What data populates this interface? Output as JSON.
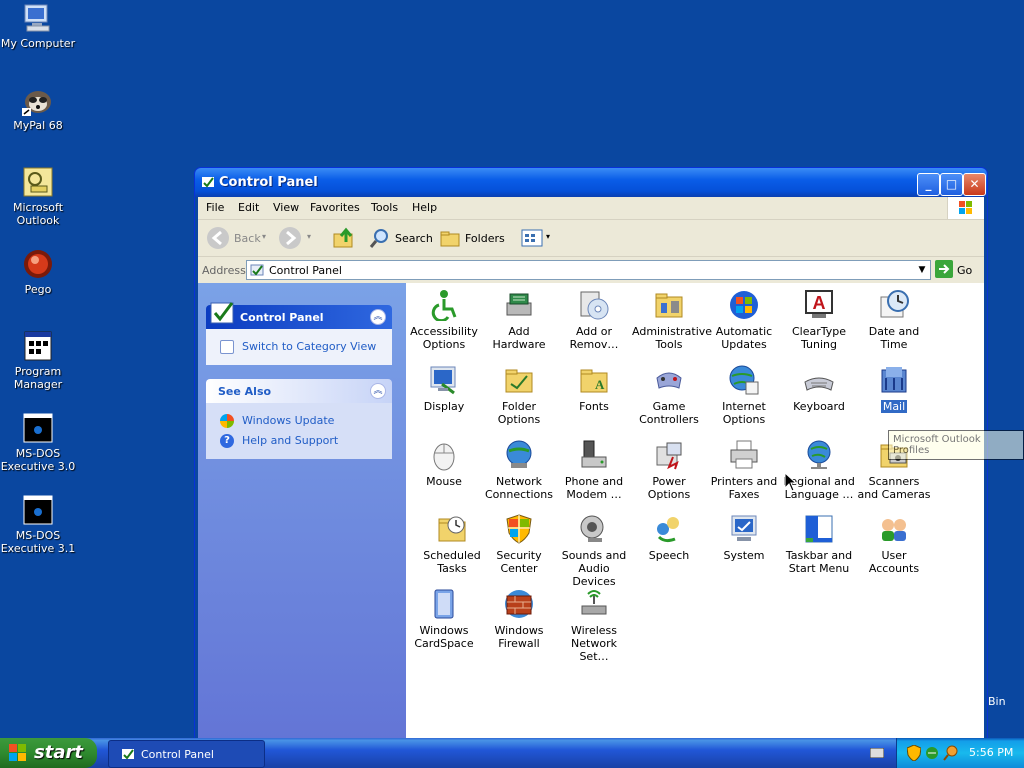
{
  "desktop": {
    "icons": [
      {
        "label": "My Computer"
      },
      {
        "label": "MyPal 68"
      },
      {
        "label": "Microsoft\nOutlook"
      },
      {
        "label": "Pego"
      },
      {
        "label": "Program\nManager"
      },
      {
        "label": "MS-DOS\nExecutive 3.0"
      },
      {
        "label": "MS-DOS\nExecutive 3.1"
      }
    ],
    "bin_label": "Bin"
  },
  "window": {
    "title": "Control Panel",
    "menu": [
      "File",
      "Edit",
      "View",
      "Favorites",
      "Tools",
      "Help"
    ],
    "toolbar": {
      "back": "Back",
      "search": "Search",
      "folders": "Folders"
    },
    "address": {
      "label": "Address",
      "value": "Control Panel",
      "go": "Go"
    }
  },
  "taskpane": {
    "control_panel": {
      "title": "Control Panel",
      "link": "Switch to Category View"
    },
    "see_also": {
      "title": "See Also",
      "links": [
        "Windows Update",
        "Help and Support"
      ]
    }
  },
  "items": [
    {
      "label": "Accessibility Options",
      "icon": "accessibility-icon"
    },
    {
      "label": "Add Hardware",
      "icon": "add-hardware-icon"
    },
    {
      "label": "Add or Remov…",
      "icon": "add-remove-programs-icon"
    },
    {
      "label": "Administrative Tools",
      "icon": "administrative-tools-icon"
    },
    {
      "label": "Automatic Updates",
      "icon": "automatic-updates-icon"
    },
    {
      "label": "ClearType Tuning",
      "icon": "cleartype-icon"
    },
    {
      "label": "Date and Time",
      "icon": "date-time-icon"
    },
    {
      "label": "Display",
      "icon": "display-icon"
    },
    {
      "label": "Folder Options",
      "icon": "folder-options-icon"
    },
    {
      "label": "Fonts",
      "icon": "fonts-icon"
    },
    {
      "label": "Game Controllers",
      "icon": "game-controllers-icon"
    },
    {
      "label": "Internet Options",
      "icon": "internet-options-icon"
    },
    {
      "label": "Keyboard",
      "icon": "keyboard-icon"
    },
    {
      "label": "Mail",
      "icon": "mail-icon",
      "selected": true
    },
    {
      "label": "Mouse",
      "icon": "mouse-icon"
    },
    {
      "label": "Network Connections",
      "icon": "network-connections-icon"
    },
    {
      "label": "Phone and Modem …",
      "icon": "phone-modem-icon"
    },
    {
      "label": "Power Options",
      "icon": "power-options-icon"
    },
    {
      "label": "Printers and Faxes",
      "icon": "printers-faxes-icon"
    },
    {
      "label": "Regional and Language …",
      "icon": "regional-language-icon"
    },
    {
      "label": "Scanners and Cameras",
      "icon": "scanners-cameras-icon"
    },
    {
      "label": "Scheduled Tasks",
      "icon": "scheduled-tasks-icon"
    },
    {
      "label": "Security Center",
      "icon": "security-center-icon"
    },
    {
      "label": "Sounds and Audio Devices",
      "icon": "sounds-audio-icon"
    },
    {
      "label": "Speech",
      "icon": "speech-icon"
    },
    {
      "label": "System",
      "icon": "system-icon"
    },
    {
      "label": "Taskbar and Start Menu",
      "icon": "taskbar-start-menu-icon"
    },
    {
      "label": "User Accounts",
      "icon": "user-accounts-icon"
    },
    {
      "label": "Windows CardSpace",
      "icon": "cardspace-icon"
    },
    {
      "label": "Windows Firewall",
      "icon": "firewall-icon"
    },
    {
      "label": "Wireless Network Set…",
      "icon": "wireless-network-icon"
    }
  ],
  "tooltip": "Microsoft Outlook Profiles",
  "taskbar": {
    "start": "start",
    "window": "Control Panel",
    "clock": "5:56 PM"
  }
}
